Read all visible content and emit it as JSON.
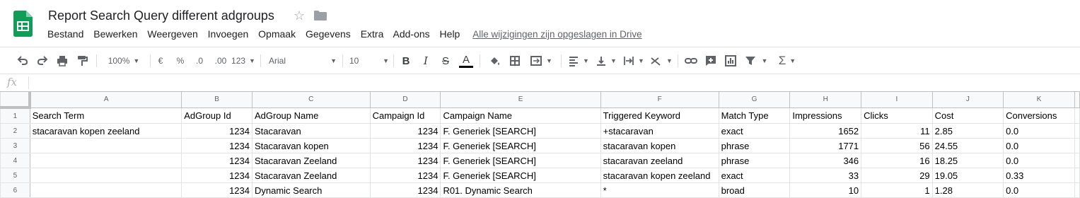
{
  "app": {
    "title": "Report Search Query different adgroups",
    "menu": [
      "Bestand",
      "Bewerken",
      "Weergeven",
      "Invoegen",
      "Opmaak",
      "Gegevens",
      "Extra",
      "Add-ons",
      "Help"
    ],
    "saved_status": "Alle wijzigingen zijn opgeslagen in Drive"
  },
  "toolbar": {
    "zoom": "100%",
    "currency": "€",
    "percent": "%",
    "decimal_less": ".0",
    "decimal_more": ".00",
    "more_formats": "123",
    "font": "Arial",
    "font_size": "10",
    "bold": "B",
    "italic": "I",
    "strike": "S",
    "text_color": "A",
    "sum": "Σ"
  },
  "formula_bar": {
    "label": "fx",
    "value": ""
  },
  "sheet": {
    "columns": [
      "A",
      "B",
      "C",
      "D",
      "E",
      "F",
      "G",
      "H",
      "I",
      "J",
      "K"
    ],
    "rows": [
      {
        "n": "1",
        "cells": [
          "Search Term",
          "AdGroup Id",
          "AdGroup Name",
          "Campaign Id",
          "Campaign Name",
          "Triggered Keyword",
          "Match Type",
          "Impressions",
          "Clicks",
          "Cost",
          "Conversions"
        ]
      },
      {
        "n": "2",
        "cells": [
          "stacaravan kopen zeeland",
          "1234",
          "Stacaravan",
          "1234",
          "F. Generiek [SEARCH]",
          "+stacaravan",
          "exact",
          "1652",
          "11",
          "2.85",
          "0.0"
        ]
      },
      {
        "n": "3",
        "cells": [
          "",
          "1234",
          "Stacaravan kopen",
          "1234",
          "F. Generiek [SEARCH]",
          "stacaravan kopen",
          "phrase",
          "1771",
          "56",
          "24.55",
          "0.0"
        ]
      },
      {
        "n": "4",
        "cells": [
          "",
          "1234",
          "Stacaravan Zeeland",
          "1234",
          "F. Generiek [SEARCH]",
          "stacaravan zeeland",
          "phrase",
          "346",
          "16",
          "18.25",
          "0.0"
        ]
      },
      {
        "n": "5",
        "cells": [
          "",
          "1234",
          "Stacaravan Zeeland",
          "1234",
          "F. Generiek [SEARCH]",
          "stacaravan kopen zeeland",
          "exact",
          "33",
          "29",
          "19.05",
          "0.33"
        ]
      },
      {
        "n": "6",
        "cells": [
          "",
          "1234",
          "Dynamic Search",
          "1234",
          "R01. Dynamic Search",
          "*",
          "broad",
          "10",
          "1",
          "1.28",
          "0.0"
        ]
      }
    ]
  },
  "colors": {
    "sheets_green": "#0f9d58",
    "grid_line": "#e2e3e3",
    "header_bg": "#f8f9fa"
  }
}
